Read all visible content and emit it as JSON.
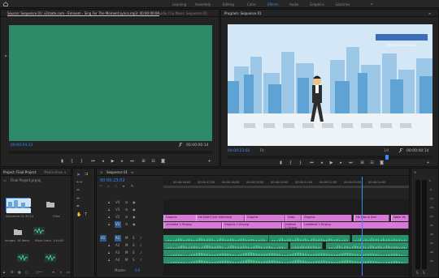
{
  "workspaces": {
    "items": [
      "Learning",
      "Assembly",
      "Editing",
      "Color",
      "Effects",
      "Audio",
      "Graphics",
      "Libraries"
    ],
    "active": "Effects"
  },
  "source": {
    "tabs": [
      "Source: Sequence 01: v2mate.com - Eminem - Sing For The Moment Lyrics.mp3: 00:00:00:00",
      "Audio Clip Mixer: Sequence 01"
    ],
    "timecode_left": "00:00:24:13",
    "timecode_right": "00:00:00:14"
  },
  "program": {
    "tab": "Program: Sequence 01",
    "caption": "He was in Sad",
    "timecode_left": "00:00:23:02",
    "fit": "Fit",
    "quality": "1/4",
    "timecode_right": "00:00:00:14"
  },
  "project": {
    "tabs": [
      "Project: Final Project",
      "Media Brow"
    ],
    "path": "Final Project.prproj",
    "items": [
      {
        "name": "Sequence 01",
        "meta": "30:14",
        "kind": "sequence"
      },
      {
        "name": "Chec",
        "meta": "",
        "kind": "folder"
      },
      {
        "name": "Images",
        "meta": "16 Items",
        "kind": "folder"
      },
      {
        "name": "Music track",
        "meta": "1:44:00",
        "kind": "audio"
      },
      {
        "name": "",
        "meta": "",
        "kind": "audio"
      },
      {
        "name": "",
        "meta": "",
        "kind": "audio"
      }
    ]
  },
  "tools": [
    "selection-tool",
    "track-select-tool",
    "ripple-edit-tool",
    "razor-tool",
    "slip-tool",
    "pen-tool",
    "hand-tool",
    "type-tool"
  ],
  "timeline": {
    "tab": "Sequence 01",
    "timecode": "00:00:23:02",
    "ruler": [
      "00:00:16:00",
      "00:00:17:00",
      "00:00:18:00",
      "00:00:19:00",
      "00:00:20:00",
      "00:00:21:00",
      "00:00:22:00",
      "00:00:23:00",
      "00:00:24:00"
    ],
    "tracks": {
      "video": [
        "V4",
        "V3",
        "V2",
        "V1"
      ],
      "audio": [
        "A1",
        "A2",
        "A3",
        "A4"
      ],
      "master": "Master",
      "master_value": "0.0"
    },
    "v1_clips": [
      "Graphic",
      "He Didn't join interview",
      "Graphic",
      "Grap",
      "Graphic",
      "He was in Sad",
      "Walki Vo"
    ],
    "v1b_clips": [
      "Unlinked 1.0V.png",
      "Graphic 1.0V.png",
      "Untitled 1.0V.png",
      "LastWord 1.0V.png"
    ]
  },
  "meter": {
    "labels": [
      "0",
      "-6",
      "-12",
      "-18",
      "-24",
      "-30",
      "-36",
      "-42",
      "-48",
      "-54"
    ],
    "footer": [
      "S",
      "S"
    ]
  },
  "colors": {
    "accent": "#3d8bff",
    "video_clip": "#d67ad6",
    "audio_clip": "#2a8f6a",
    "source_frame": "#2e8a68"
  }
}
